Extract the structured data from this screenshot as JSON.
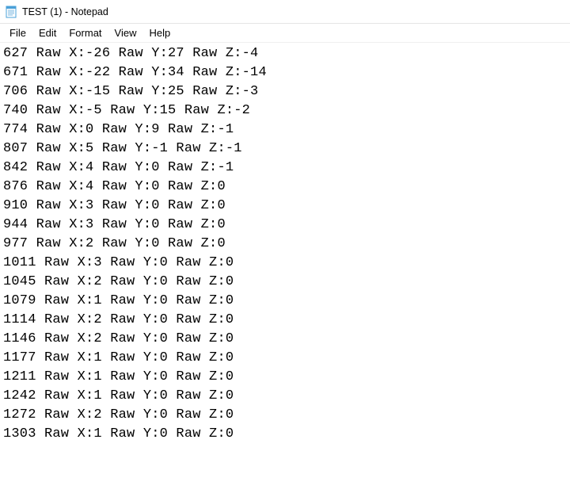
{
  "window": {
    "title": "TEST (1) - Notepad"
  },
  "menu": {
    "file": "File",
    "edit": "Edit",
    "format": "Format",
    "view": "View",
    "help": "Help"
  },
  "lines": [
    "627 Raw X:-26 Raw Y:27 Raw Z:-4",
    "671 Raw X:-22 Raw Y:34 Raw Z:-14",
    "706 Raw X:-15 Raw Y:25 Raw Z:-3",
    "740 Raw X:-5 Raw Y:15 Raw Z:-2",
    "774 Raw X:0 Raw Y:9 Raw Z:-1",
    "807 Raw X:5 Raw Y:-1 Raw Z:-1",
    "842 Raw X:4 Raw Y:0 Raw Z:-1",
    "876 Raw X:4 Raw Y:0 Raw Z:0",
    "910 Raw X:3 Raw Y:0 Raw Z:0",
    "944 Raw X:3 Raw Y:0 Raw Z:0",
    "977 Raw X:2 Raw Y:0 Raw Z:0",
    "1011 Raw X:3 Raw Y:0 Raw Z:0",
    "1045 Raw X:2 Raw Y:0 Raw Z:0",
    "1079 Raw X:1 Raw Y:0 Raw Z:0",
    "1114 Raw X:2 Raw Y:0 Raw Z:0",
    "1146 Raw X:2 Raw Y:0 Raw Z:0",
    "1177 Raw X:1 Raw Y:0 Raw Z:0",
    "1211 Raw X:1 Raw Y:0 Raw Z:0",
    "1242 Raw X:1 Raw Y:0 Raw Z:0",
    "1272 Raw X:2 Raw Y:0 Raw Z:0",
    "1303 Raw X:1 Raw Y:0 Raw Z:0"
  ]
}
